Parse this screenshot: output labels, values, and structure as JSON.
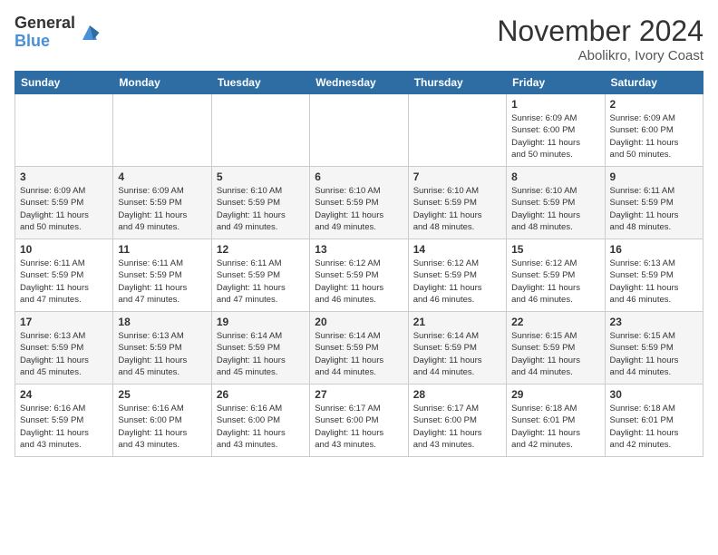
{
  "logo": {
    "line1": "General",
    "line2": "Blue"
  },
  "title": "November 2024",
  "location": "Abolikro, Ivory Coast",
  "weekdays": [
    "Sunday",
    "Monday",
    "Tuesday",
    "Wednesday",
    "Thursday",
    "Friday",
    "Saturday"
  ],
  "rows": [
    [
      {
        "day": "",
        "text": ""
      },
      {
        "day": "",
        "text": ""
      },
      {
        "day": "",
        "text": ""
      },
      {
        "day": "",
        "text": ""
      },
      {
        "day": "",
        "text": ""
      },
      {
        "day": "1",
        "text": "Sunrise: 6:09 AM\nSunset: 6:00 PM\nDaylight: 11 hours\nand 50 minutes."
      },
      {
        "day": "2",
        "text": "Sunrise: 6:09 AM\nSunset: 6:00 PM\nDaylight: 11 hours\nand 50 minutes."
      }
    ],
    [
      {
        "day": "3",
        "text": "Sunrise: 6:09 AM\nSunset: 5:59 PM\nDaylight: 11 hours\nand 50 minutes."
      },
      {
        "day": "4",
        "text": "Sunrise: 6:09 AM\nSunset: 5:59 PM\nDaylight: 11 hours\nand 49 minutes."
      },
      {
        "day": "5",
        "text": "Sunrise: 6:10 AM\nSunset: 5:59 PM\nDaylight: 11 hours\nand 49 minutes."
      },
      {
        "day": "6",
        "text": "Sunrise: 6:10 AM\nSunset: 5:59 PM\nDaylight: 11 hours\nand 49 minutes."
      },
      {
        "day": "7",
        "text": "Sunrise: 6:10 AM\nSunset: 5:59 PM\nDaylight: 11 hours\nand 48 minutes."
      },
      {
        "day": "8",
        "text": "Sunrise: 6:10 AM\nSunset: 5:59 PM\nDaylight: 11 hours\nand 48 minutes."
      },
      {
        "day": "9",
        "text": "Sunrise: 6:11 AM\nSunset: 5:59 PM\nDaylight: 11 hours\nand 48 minutes."
      }
    ],
    [
      {
        "day": "10",
        "text": "Sunrise: 6:11 AM\nSunset: 5:59 PM\nDaylight: 11 hours\nand 47 minutes."
      },
      {
        "day": "11",
        "text": "Sunrise: 6:11 AM\nSunset: 5:59 PM\nDaylight: 11 hours\nand 47 minutes."
      },
      {
        "day": "12",
        "text": "Sunrise: 6:11 AM\nSunset: 5:59 PM\nDaylight: 11 hours\nand 47 minutes."
      },
      {
        "day": "13",
        "text": "Sunrise: 6:12 AM\nSunset: 5:59 PM\nDaylight: 11 hours\nand 46 minutes."
      },
      {
        "day": "14",
        "text": "Sunrise: 6:12 AM\nSunset: 5:59 PM\nDaylight: 11 hours\nand 46 minutes."
      },
      {
        "day": "15",
        "text": "Sunrise: 6:12 AM\nSunset: 5:59 PM\nDaylight: 11 hours\nand 46 minutes."
      },
      {
        "day": "16",
        "text": "Sunrise: 6:13 AM\nSunset: 5:59 PM\nDaylight: 11 hours\nand 46 minutes."
      }
    ],
    [
      {
        "day": "17",
        "text": "Sunrise: 6:13 AM\nSunset: 5:59 PM\nDaylight: 11 hours\nand 45 minutes."
      },
      {
        "day": "18",
        "text": "Sunrise: 6:13 AM\nSunset: 5:59 PM\nDaylight: 11 hours\nand 45 minutes."
      },
      {
        "day": "19",
        "text": "Sunrise: 6:14 AM\nSunset: 5:59 PM\nDaylight: 11 hours\nand 45 minutes."
      },
      {
        "day": "20",
        "text": "Sunrise: 6:14 AM\nSunset: 5:59 PM\nDaylight: 11 hours\nand 44 minutes."
      },
      {
        "day": "21",
        "text": "Sunrise: 6:14 AM\nSunset: 5:59 PM\nDaylight: 11 hours\nand 44 minutes."
      },
      {
        "day": "22",
        "text": "Sunrise: 6:15 AM\nSunset: 5:59 PM\nDaylight: 11 hours\nand 44 minutes."
      },
      {
        "day": "23",
        "text": "Sunrise: 6:15 AM\nSunset: 5:59 PM\nDaylight: 11 hours\nand 44 minutes."
      }
    ],
    [
      {
        "day": "24",
        "text": "Sunrise: 6:16 AM\nSunset: 5:59 PM\nDaylight: 11 hours\nand 43 minutes."
      },
      {
        "day": "25",
        "text": "Sunrise: 6:16 AM\nSunset: 6:00 PM\nDaylight: 11 hours\nand 43 minutes."
      },
      {
        "day": "26",
        "text": "Sunrise: 6:16 AM\nSunset: 6:00 PM\nDaylight: 11 hours\nand 43 minutes."
      },
      {
        "day": "27",
        "text": "Sunrise: 6:17 AM\nSunset: 6:00 PM\nDaylight: 11 hours\nand 43 minutes."
      },
      {
        "day": "28",
        "text": "Sunrise: 6:17 AM\nSunset: 6:00 PM\nDaylight: 11 hours\nand 43 minutes."
      },
      {
        "day": "29",
        "text": "Sunrise: 6:18 AM\nSunset: 6:01 PM\nDaylight: 11 hours\nand 42 minutes."
      },
      {
        "day": "30",
        "text": "Sunrise: 6:18 AM\nSunset: 6:01 PM\nDaylight: 11 hours\nand 42 minutes."
      }
    ]
  ]
}
